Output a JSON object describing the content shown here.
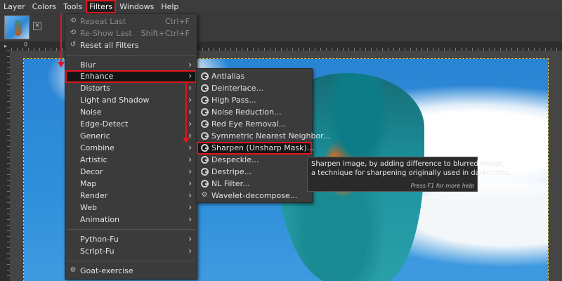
{
  "menubar": {
    "items": [
      "Layer",
      "Colors",
      "Tools",
      "Filters",
      "Windows",
      "Help"
    ],
    "active": "Filters"
  },
  "canvas": {
    "image": "kingfisher-bird-on-blue-sky",
    "ruler_label": "0"
  },
  "filters_menu": {
    "top_items": [
      {
        "label": "Repeat Last",
        "shortcut": "Ctrl+F",
        "disabled": true
      },
      {
        "label": "Re-Show Last",
        "shortcut": "Shift+Ctrl+F",
        "disabled": true
      },
      {
        "label": "Reset all Filters",
        "shortcut": "",
        "disabled": false
      }
    ],
    "categories": [
      "Blur",
      "Enhance",
      "Distorts",
      "Light and Shadow",
      "Noise",
      "Edge-Detect",
      "Generic",
      "Combine",
      "Artistic",
      "Decor",
      "Map",
      "Render",
      "Web",
      "Animation"
    ],
    "highlighted": "Enhance",
    "script_items": [
      "Python-Fu",
      "Script-Fu"
    ],
    "bottom_item": "Goat-exercise"
  },
  "enhance_menu": {
    "items": [
      "Antialias",
      "Deinterlace...",
      "High Pass...",
      "Noise Reduction...",
      "Red Eye Removal...",
      "Symmetric Nearest Neighbor...",
      "Sharpen (Unsharp Mask)...",
      "Despeckle...",
      "Destripe...",
      "NL Filter...",
      "Wavelet-decompose..."
    ],
    "highlighted": "Sharpen (Unsharp Mask)..."
  },
  "tooltip": {
    "line1": "Sharpen image, by adding difference to blurred image,",
    "line2": "a technique for sharpening originally used in darkrooms.",
    "hint": "Press F1 for more help"
  },
  "colors": {
    "highlight_border": "#e0161e",
    "menu_bg": "#3b3b3b",
    "sky": "#2f8fda"
  }
}
